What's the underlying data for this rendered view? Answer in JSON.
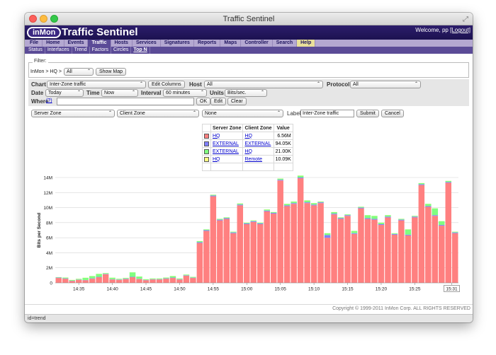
{
  "window": {
    "title": "Traffic Sentinel"
  },
  "header": {
    "logo": "inMon",
    "app_title": "Traffic Sentinel",
    "welcome": "Welcome, pp",
    "logout": "[Logout]"
  },
  "menu": [
    "File",
    "Home",
    "Events",
    "Traffic",
    "Hosts",
    "Services",
    "Signatures",
    "Reports",
    "Maps",
    "Controller",
    "Search",
    "Help"
  ],
  "submenu": [
    "Status",
    "Interfaces",
    "Trend",
    "Factors",
    "Circles",
    "Top N"
  ],
  "filter": {
    "legend": "Filter:",
    "path_label": "InMon > HQ >",
    "scope_value": "All",
    "show_map_label": "Show Map"
  },
  "controls": {
    "chart_label": "Chart",
    "chart_value": "Inter-Zone traffic",
    "edit_columns_label": "Edit Columns",
    "host_label": "Host",
    "host_value": "All",
    "protocol_label": "Protocol",
    "protocol_value": "All",
    "date_label": "Date",
    "date_value": "Today",
    "time_label": "Time",
    "time_value": "Now",
    "interval_label": "Interval",
    "interval_value": "60 minutes",
    "units_label": "Units",
    "units_value": "Bits/sec.",
    "where_label": "Where",
    "where_help": "(?)",
    "where_value": "",
    "ok_label": "OK",
    "edit_label": "Edit",
    "clear_label": "Clear",
    "group1_value": "Server Zone",
    "group2_value": "Client Zone",
    "group3_value": "None",
    "label_label": "Label",
    "label_value": "Inter-Zone traffic",
    "submit_label": "Submit",
    "cancel_label": "Cancel"
  },
  "legend_table": {
    "headers": [
      "Server Zone",
      "Client Zone",
      "Value"
    ],
    "rows": [
      {
        "server": "HQ",
        "client": "HQ",
        "value": "6.56M",
        "color": "#ff8080"
      },
      {
        "server": "EXTERNAL",
        "client": "EXTERNAL",
        "value": "94.05K",
        "color": "#8080ff"
      },
      {
        "server": "EXTERNAL",
        "client": "HQ",
        "value": "21.00K",
        "color": "#80ff80"
      },
      {
        "server": "HQ",
        "client": "Remote",
        "value": "10.09K",
        "color": "#ffff80"
      }
    ]
  },
  "footer": {
    "copyright": "Copyright © 1999-2011 InMon Corp. ALL RIGHTS RESERVED",
    "status": "id=trend"
  },
  "chart_data": {
    "type": "bar",
    "stacked": true,
    "ylabel": "Bits per Second",
    "yticks": [
      "0",
      "2M",
      "4M",
      "6M",
      "8M",
      "10M",
      "12M",
      "14M"
    ],
    "ylim": [
      0,
      14000000
    ],
    "xticks": [
      "14:35",
      "14:40",
      "14:45",
      "14:50",
      "14:55",
      "15:00",
      "15:05",
      "15:10",
      "15:15",
      "15:20",
      "15:25",
      "15:31"
    ],
    "grid": true,
    "series": [
      {
        "name": "HQ / HQ",
        "color": "#ff8080",
        "values": [
          0.65,
          0.55,
          0.25,
          0.4,
          0.35,
          0.55,
          0.75,
          1.15,
          0.45,
          0.4,
          0.5,
          0.75,
          0.5,
          0.35,
          0.45,
          0.45,
          0.55,
          0.65,
          0.45,
          0.95,
          0.65,
          5.3,
          6.9,
          11.5,
          8.3,
          8.5,
          6.6,
          10.3,
          7.8,
          8.1,
          7.8,
          9.5,
          9.2,
          13.6,
          10.2,
          10.5,
          13.9,
          10.6,
          10.3,
          10.6,
          6.0,
          9.1,
          8.5,
          8.9,
          6.5,
          9.9,
          8.5,
          8.4,
          7.7,
          8.7,
          6.4,
          8.3,
          6.3,
          8.7,
          13.0,
          10.1,
          8.9,
          7.6,
          13.3,
          6.6
        ]
      },
      {
        "name": "EXTERNAL / EXTERNAL",
        "color": "#8080ff",
        "values": [
          0.05,
          0.05,
          0.03,
          0.03,
          0.03,
          0.05,
          0.05,
          0.05,
          0.04,
          0.04,
          0.05,
          0.05,
          0.04,
          0.03,
          0.04,
          0.04,
          0.05,
          0.05,
          0.04,
          0.05,
          0.04,
          0.1,
          0.1,
          0.1,
          0.1,
          0.1,
          0.1,
          0.1,
          0.1,
          0.1,
          0.1,
          0.1,
          0.1,
          0.1,
          0.1,
          0.1,
          0.1,
          0.1,
          0.1,
          0.1,
          0.35,
          0.1,
          0.1,
          0.1,
          0.1,
          0.1,
          0.1,
          0.1,
          0.1,
          0.1,
          0.1,
          0.1,
          0.1,
          0.1,
          0.1,
          0.1,
          0.1,
          0.1,
          0.1,
          0.1
        ]
      },
      {
        "name": "EXTERNAL / HQ",
        "color": "#80ff80",
        "values": [
          0.05,
          0.1,
          0.1,
          0.1,
          0.3,
          0.3,
          0.4,
          0.1,
          0.2,
          0.1,
          0.1,
          0.6,
          0.3,
          0.1,
          0.1,
          0.1,
          0.1,
          0.2,
          0.1,
          0.1,
          0.1,
          0.15,
          0.1,
          0.1,
          0.1,
          0.1,
          0.1,
          0.15,
          0.1,
          0.1,
          0.1,
          0.15,
          0.1,
          0.15,
          0.2,
          0.2,
          0.25,
          0.25,
          0.2,
          0.1,
          0.25,
          0.2,
          0.1,
          0.1,
          0.3,
          0.1,
          0.4,
          0.4,
          0.2,
          0.2,
          0.1,
          0.1,
          0.7,
          0.1,
          0.15,
          0.3,
          0.9,
          0.5,
          0.15,
          0.1
        ]
      },
      {
        "name": "HQ / Remote",
        "color": "#ffff80",
        "values": [
          0.02,
          0.02,
          0.02,
          0.02,
          0.02,
          0.02,
          0.02,
          0.02,
          0.02,
          0.02,
          0.02,
          0.02,
          0.02,
          0.02,
          0.02,
          0.02,
          0.02,
          0.02,
          0.02,
          0.02,
          0.02,
          0.02,
          0.02,
          0.02,
          0.02,
          0.02,
          0.02,
          0.02,
          0.02,
          0.02,
          0.02,
          0.02,
          0.02,
          0.02,
          0.02,
          0.02,
          0.02,
          0.02,
          0.02,
          0.02,
          0.02,
          0.02,
          0.02,
          0.02,
          0.02,
          0.02,
          0.02,
          0.02,
          0.02,
          0.02,
          0.02,
          0.02,
          0.02,
          0.02,
          0.02,
          0.02,
          0.02,
          0.02,
          0.02,
          0.02
        ]
      }
    ],
    "value_unit": "M"
  }
}
